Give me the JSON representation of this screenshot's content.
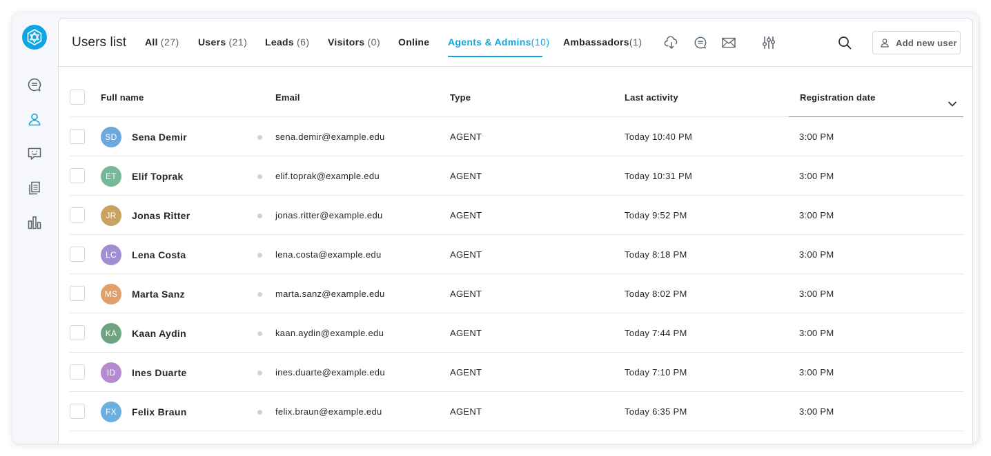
{
  "sidebar": {
    "logo_icon": "hexagon-logo-icon",
    "items": [
      {
        "name": "conversations",
        "icon": "chat-bubble-icon",
        "active": false
      },
      {
        "name": "users",
        "icon": "user-icon",
        "active": true
      },
      {
        "name": "chatbot",
        "icon": "smiley-chat-icon",
        "active": false
      },
      {
        "name": "articles",
        "icon": "documents-icon",
        "active": false
      },
      {
        "name": "reports",
        "icon": "bar-chart-icon",
        "active": false
      }
    ]
  },
  "header": {
    "title": "Users list",
    "tabs": [
      {
        "label": "All",
        "count": "(27)",
        "active": false
      },
      {
        "label": "Users",
        "count": "(21)",
        "active": false
      },
      {
        "label": "Leads",
        "count": "(6)",
        "active": false
      },
      {
        "label": "Visitors",
        "count": "(0)",
        "active": false
      },
      {
        "label": "Online",
        "count": "",
        "active": false
      },
      {
        "label": "Agents & Admins",
        "count": "(10)",
        "active": true
      },
      {
        "label": "Ambassadors",
        "count": "(1)",
        "active": false
      }
    ],
    "tool_icons": [
      "cloud-download-icon",
      "chat-bubble-icon",
      "envelope-icon",
      "filter-sliders-icon"
    ],
    "search_icon": "search-icon",
    "add_button_label": "Add new user"
  },
  "colors": {
    "accent": "#0da6e3",
    "text": "#24272a",
    "muted": "#566069",
    "border": "#dbdee2"
  },
  "table": {
    "columns": {
      "full_name": "Full name",
      "email": "Email",
      "type": "Type",
      "last_activity": "Last activity",
      "registration_date": "Registration date"
    },
    "rows": [
      {
        "initials": "SD",
        "color": "#6aa8dd",
        "name": "Sena Demir",
        "email": "sena.demir@example.edu",
        "type": "AGENT",
        "last_activity": "Today 10:40 PM",
        "registration": "3:00 PM"
      },
      {
        "initials": "ET",
        "color": "#76b897",
        "name": "Elif Toprak",
        "email": "elif.toprak@example.edu",
        "type": "AGENT",
        "last_activity": "Today 10:31 PM",
        "registration": "3:00 PM"
      },
      {
        "initials": "JR",
        "color": "#c9a25f",
        "name": "Jonas Ritter",
        "email": "jonas.ritter@example.edu",
        "type": "AGENT",
        "last_activity": "Today 9:52 PM",
        "registration": "3:00 PM"
      },
      {
        "initials": "LC",
        "color": "#9f8fd0",
        "name": "Lena Costa",
        "email": "lena.costa@example.edu",
        "type": "AGENT",
        "last_activity": "Today 8:18 PM",
        "registration": "3:00 PM"
      },
      {
        "initials": "MS",
        "color": "#e0a06a",
        "name": "Marta Sanz",
        "email": "marta.sanz@example.edu",
        "type": "AGENT",
        "last_activity": "Today 8:02 PM",
        "registration": "3:00 PM"
      },
      {
        "initials": "KA",
        "color": "#6fa481",
        "name": "Kaan Aydin",
        "email": "kaan.aydin@example.edu",
        "type": "AGENT",
        "last_activity": "Today 7:44 PM",
        "registration": "3:00 PM"
      },
      {
        "initials": "ID",
        "color": "#b58acf",
        "name": "Ines Duarte",
        "email": "ines.duarte@example.edu",
        "type": "AGENT",
        "last_activity": "Today 7:10 PM",
        "registration": "3:00 PM"
      },
      {
        "initials": "FX",
        "color": "#6caee0",
        "name": "Felix Braun",
        "email": "felix.braun@example.edu",
        "type": "AGENT",
        "last_activity": "Today 6:35 PM",
        "registration": "3:00 PM"
      }
    ]
  }
}
